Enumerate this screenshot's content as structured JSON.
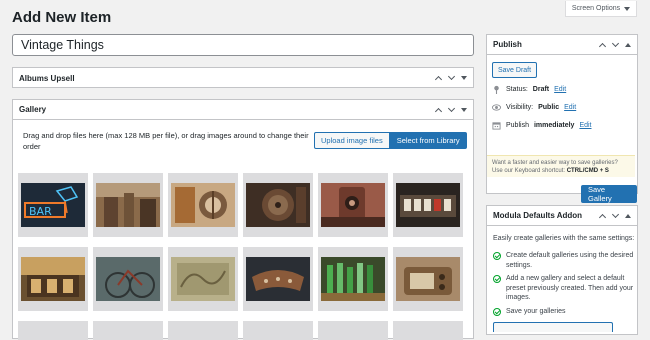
{
  "header": {
    "title": "Add New Item",
    "screen_options": "Screen Options"
  },
  "post": {
    "title_value": "Vintage Things"
  },
  "albums_upsell": {
    "title": "Albums Upsell"
  },
  "gallery": {
    "title": "Gallery",
    "instructions": "Drag and drop files here (max 128 MB per file), or drag images around to change their order",
    "upload_label": "Upload image files",
    "library_label": "Select from Library"
  },
  "publish": {
    "title": "Publish",
    "save_draft": "Save Draft",
    "status_label": "Status:",
    "status_value": "Draft",
    "visibility_label": "Visibility:",
    "visibility_value": "Public",
    "publish_label": "Publish",
    "publish_value": "immediately",
    "edit": "Edit",
    "hint_text": "Want a faster and easier way to save galleries? Use our Keyboard shortcut:",
    "hint_shortcut": "CTRL/CMD + S",
    "save_gallery": "Save Gallery"
  },
  "defaults_addon": {
    "title": "Modula Defaults Addon",
    "intro": "Easily create galleries with the same settings:",
    "items": [
      "Create default galleries using the desired settings.",
      "Add a new gallery and select a default preset previously created. Then add your images.",
      "Save your galleries"
    ]
  },
  "icons": {
    "status": "pin-icon",
    "visibility": "eye-icon",
    "calendar": "calendar-icon",
    "check": "check-circle-icon"
  },
  "colors": {
    "accent": "#2271b1",
    "background": "#f1f1f1",
    "border": "#c3c4c7",
    "success": "#00a32a"
  }
}
